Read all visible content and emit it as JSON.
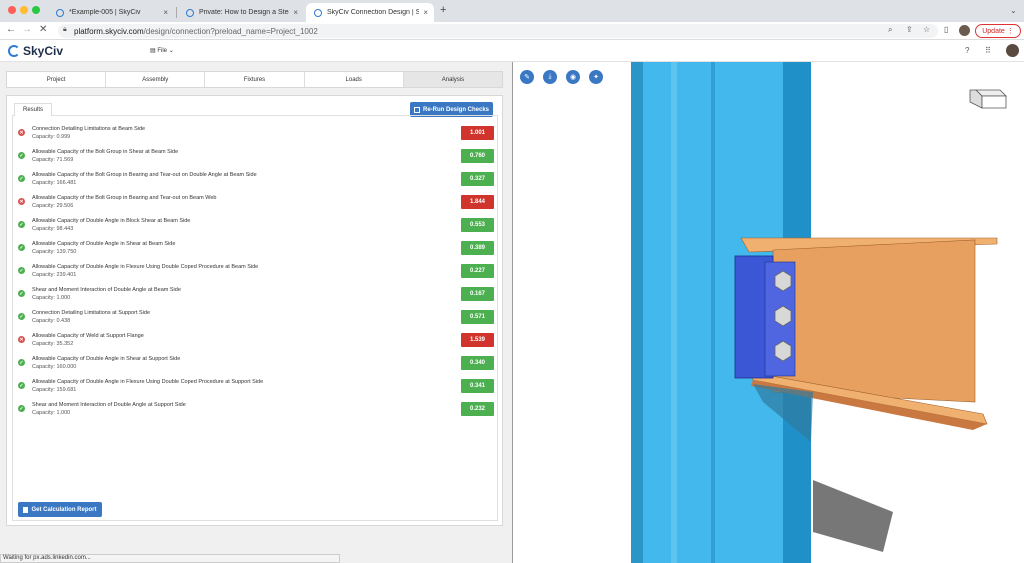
{
  "browser": {
    "tabs": [
      {
        "title": "*Example-005 | SkyCiv",
        "close": "×"
      },
      {
        "title": "Private: How to Design a Steel",
        "close": "×"
      },
      {
        "title": "SkyCiv Connection Design | Sk",
        "close": "×"
      }
    ],
    "new_tab": "+",
    "url_host": "platform.skyciv.com",
    "url_path": "/design/connection?preload_name=Project_1002",
    "update_label": "Update",
    "menu_glyph": "⋮"
  },
  "app": {
    "logo_text": "SkyCiv",
    "file_menu": "File",
    "help_glyph": "?",
    "apps_glyph": "⠿"
  },
  "steps": [
    "Project",
    "Assembly",
    "Fixtures",
    "Loads",
    "Analysis"
  ],
  "results": {
    "tab_label": "Results",
    "rerun_label": "Re-Run Design Checks",
    "report_label": "Get Calculation Report",
    "capacity_prefix": "Capacity: ",
    "checks": [
      {
        "name": "Connection Detailing Limitations at Beam Side",
        "capacity": "0.999",
        "ratio": "1.001",
        "status": "fail"
      },
      {
        "name": "Allowable Capacity of the Bolt Group in Shear at Beam Side",
        "capacity": "71.569",
        "ratio": "0.760",
        "status": "pass"
      },
      {
        "name": "Allowable Capacity of the Bolt Group in Bearing and Tear-out on Double Angle at Beam Side",
        "capacity": "166.481",
        "ratio": "0.327",
        "status": "pass"
      },
      {
        "name": "Allowable Capacity of the Bolt Group in Bearing and Tear-out on Beam Web",
        "capacity": "29.506",
        "ratio": "1.844",
        "status": "fail"
      },
      {
        "name": "Allowable Capacity of Double Angle in Block Shear at Beam Side",
        "capacity": "98.443",
        "ratio": "0.553",
        "status": "pass"
      },
      {
        "name": "Allowable Capacity of Double Angle in Shear at Beam Side",
        "capacity": "139.750",
        "ratio": "0.389",
        "status": "pass"
      },
      {
        "name": "Allowable Capacity of Double Angle in Flexure Using Double Coped Procedure at Beam Side",
        "capacity": "239.401",
        "ratio": "0.227",
        "status": "pass"
      },
      {
        "name": "Shear and Moment Interaction of Double Angle at Beam Side",
        "capacity": "1.000",
        "ratio": "0.167",
        "status": "pass"
      },
      {
        "name": "Connection Detailing Limitations at Support Side",
        "capacity": "0.438",
        "ratio": "0.571",
        "status": "pass"
      },
      {
        "name": "Allowable Capacity of Weld at Support Flange",
        "capacity": "35.352",
        "ratio": "1.539",
        "status": "fail"
      },
      {
        "name": "Allowable Capacity of Double Angle in Shear at Support Side",
        "capacity": "160.000",
        "ratio": "0.340",
        "status": "pass"
      },
      {
        "name": "Allowable Capacity of Double Angle in Flexure Using Double Coped Procedure at Support Side",
        "capacity": "159.681",
        "ratio": "0.341",
        "status": "pass"
      },
      {
        "name": "Shear and Moment Interaction of Double Angle at Support Side",
        "capacity": "1.000",
        "ratio": "0.232",
        "status": "pass"
      }
    ]
  },
  "status_bar": "Waiting for px.ads.linkedin.com...",
  "colors": {
    "pass": "#4caf50",
    "fail": "#d0342c",
    "accent": "#3a78c3",
    "column": "#3fb5ea",
    "beam": "#e8a060",
    "plate": "#3b57d6"
  }
}
